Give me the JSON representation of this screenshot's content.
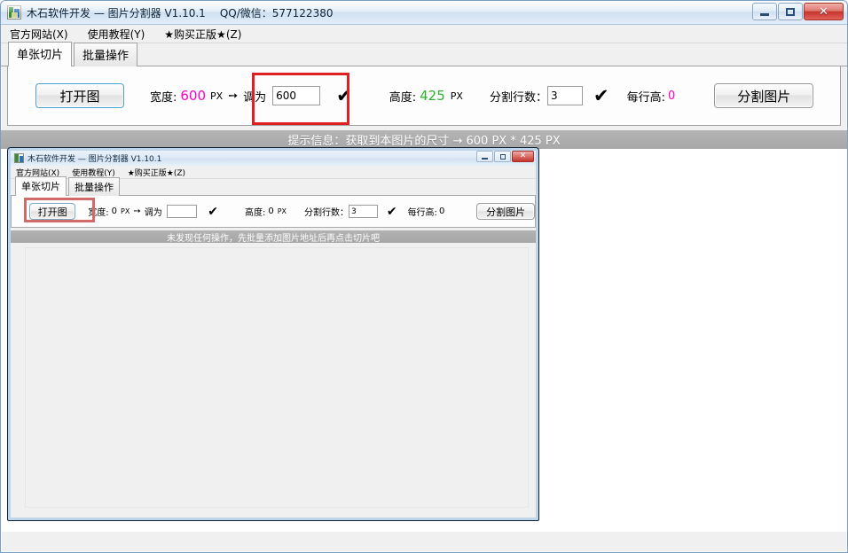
{
  "main_window": {
    "title": "木石软件开发 — 图片分割器 V1.10.1",
    "title_qq": "QQ/微信：577122380",
    "icon": "app-icon",
    "controls": {
      "minimize": "–",
      "maximize": "□",
      "close": "✕"
    },
    "menu": [
      {
        "label": "官方网站(X)"
      },
      {
        "label": "使用教程(Y)"
      },
      {
        "label": "★购买正版★(Z)"
      }
    ],
    "tabs": [
      {
        "label": "单张切片",
        "active": true
      },
      {
        "label": "批量操作",
        "active": false
      }
    ],
    "toolbar": {
      "open_button": "打开图",
      "width_label": "宽度:",
      "width_value": "600",
      "width_unit": "PX",
      "arrow": "➙",
      "adjust_label": "调为",
      "adjust_input_value": "600",
      "confirm_check": "✔",
      "height_label": "高度:",
      "height_value": "425",
      "height_unit": "PX",
      "rows_label": "分割行数：",
      "rows_value": "3",
      "rows_check": "✔",
      "per_row_label": "每行高:",
      "per_row_value": "0",
      "split_button": "分割图片"
    },
    "status": "提示信息：获取到本图片的尺寸 → 600 PX * 425 PX"
  },
  "inner_window": {
    "title": "木石软件开发 — 图片分割器 V1.10.1",
    "icon": "app-icon",
    "controls": {
      "minimize": "–",
      "maximize": "□",
      "close": "✕"
    },
    "menu": [
      {
        "label": "官方网站(X)"
      },
      {
        "label": "使用教程(Y)"
      },
      {
        "label": "★购买正版★(Z)"
      }
    ],
    "tabs": [
      {
        "label": "单张切片",
        "active": true
      },
      {
        "label": "批量操作",
        "active": false
      }
    ],
    "toolbar": {
      "open_button": "打开图",
      "width_label": "宽度:",
      "width_value": "0",
      "width_unit": "PX",
      "arrow": "➙",
      "adjust_label": "调为",
      "adjust_input_value": "",
      "confirm_check": "✔",
      "height_label": "高度:",
      "height_value": "0",
      "height_unit": "PX",
      "rows_label": "分割行数：",
      "rows_value": "3",
      "rows_check": "✔",
      "per_row_label": "每行高:",
      "per_row_value": "0",
      "split_button": "分割图片"
    },
    "status": "未发现任何操作，先批量添加图片地址后再点击切片吧"
  },
  "colors": {
    "accent_pink": "#ff00c8",
    "accent_green": "#2cb12c",
    "highlight_red": "#e02020",
    "status_gray": "#aaaaaa",
    "title_blue": "#cfe0f2"
  }
}
